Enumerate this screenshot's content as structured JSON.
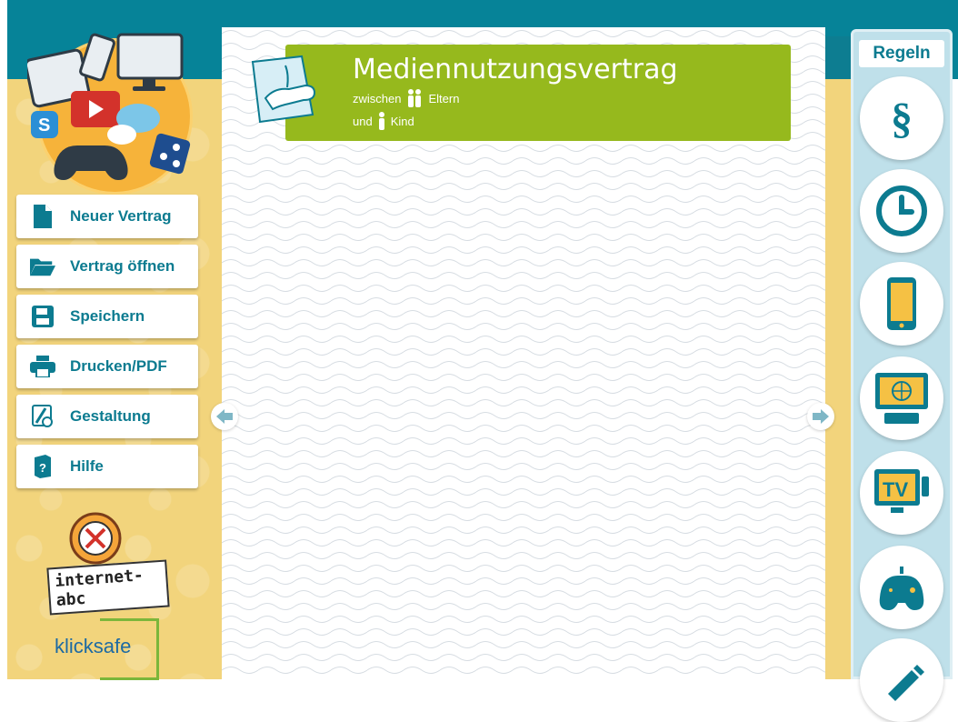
{
  "menu": {
    "items": [
      {
        "label": "Neuer Vertrag",
        "icon": "new-file-icon"
      },
      {
        "label": "Vertrag öffnen",
        "icon": "folder-open-icon"
      },
      {
        "label": "Speichern",
        "icon": "save-icon"
      },
      {
        "label": "Drucken/PDF",
        "icon": "print-icon"
      },
      {
        "label": "Gestaltung",
        "icon": "design-icon"
      },
      {
        "label": "Hilfe",
        "icon": "help-book-icon"
      }
    ]
  },
  "banner": {
    "title": "Mediennutzungsvertrag",
    "line1_prefix": "zwischen",
    "line1_suffix": "Eltern",
    "line2_prefix": "und",
    "line2_suffix": "Kind"
  },
  "rules": {
    "title": "Regeln",
    "items": [
      {
        "icon": "paragraph-icon",
        "symbol": "§"
      },
      {
        "icon": "clock-icon"
      },
      {
        "icon": "smartphone-icon"
      },
      {
        "icon": "computer-internet-icon"
      },
      {
        "icon": "tv-icon",
        "symbol": "TV"
      },
      {
        "icon": "gamepad-icon"
      },
      {
        "icon": "pencil-icon"
      }
    ]
  },
  "logos": {
    "internet_abc": "internet-abc",
    "klicksafe": "klicksafe"
  },
  "colors": {
    "teal": "#068398",
    "label": "#0c7b90",
    "green": "#96b91d",
    "yellow_bg": "#f2d47c",
    "panel": "#bfe0ea"
  }
}
